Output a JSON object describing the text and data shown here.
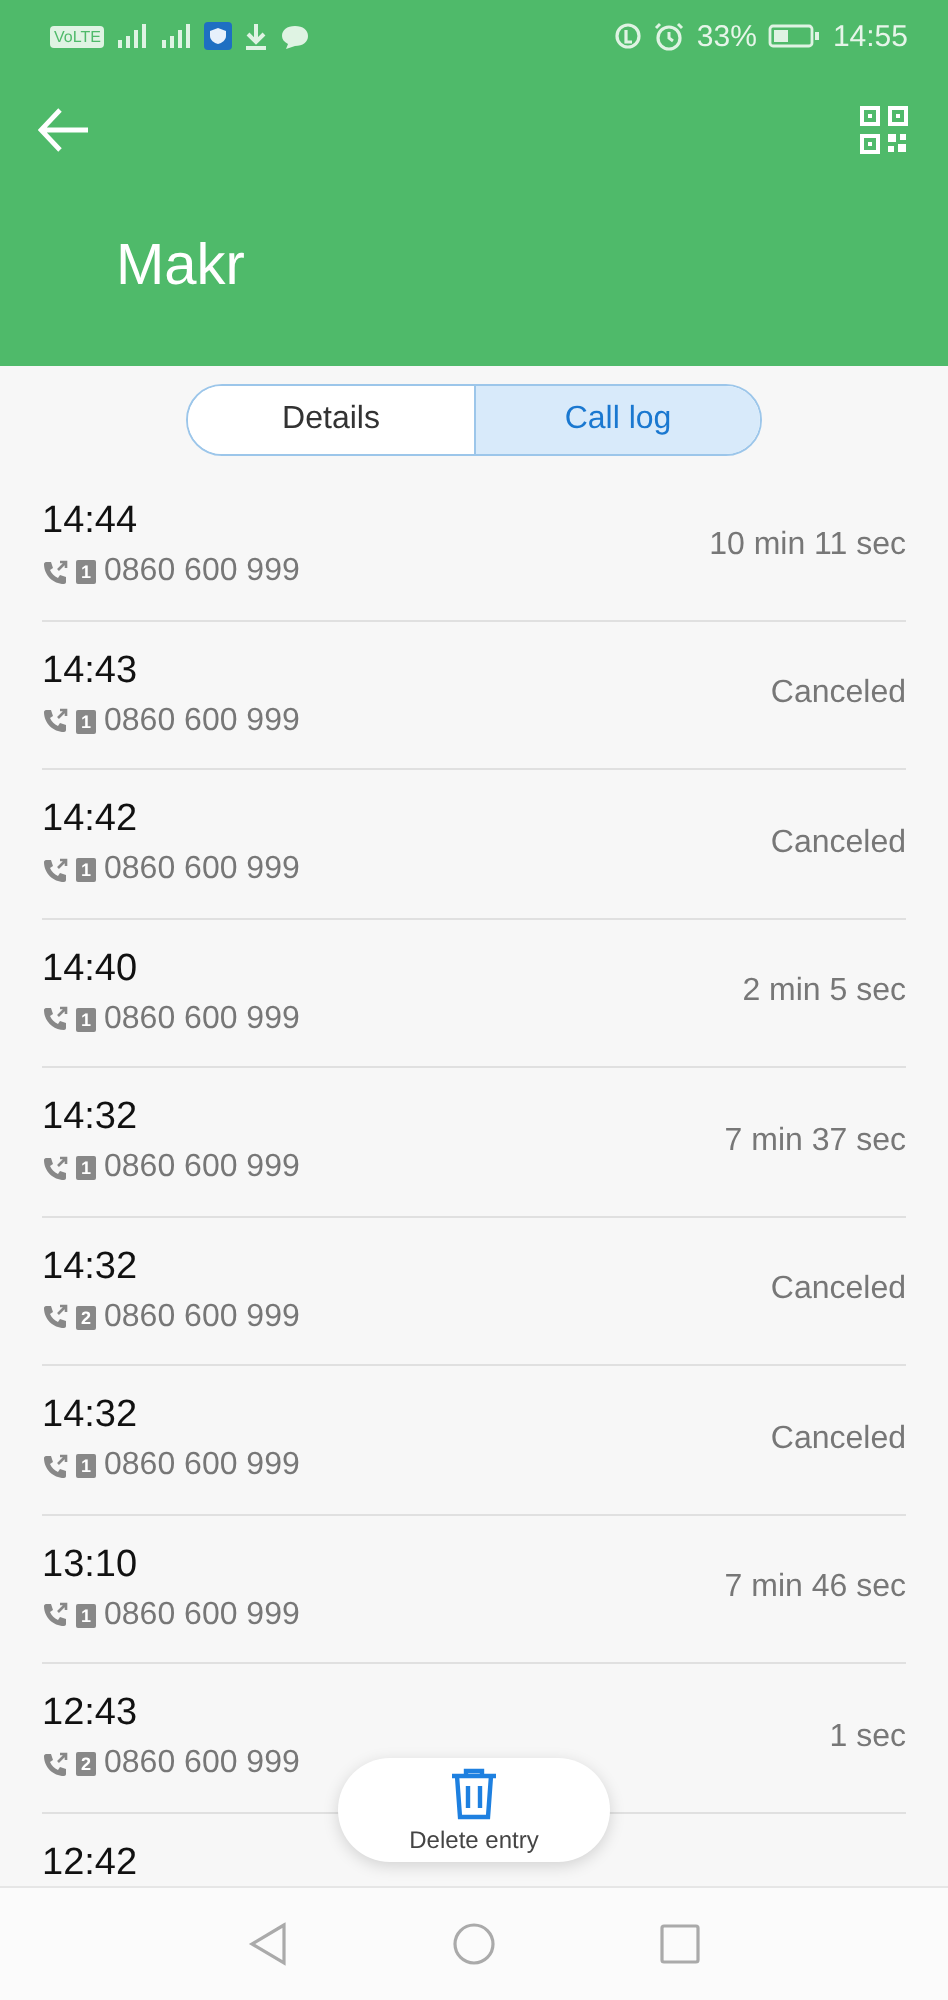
{
  "status_bar": {
    "volte": "VoLTE",
    "battery": "33%",
    "time": "14:55"
  },
  "header": {
    "title": "Makr"
  },
  "tabs": [
    {
      "label": "Details",
      "selected": false
    },
    {
      "label": "Call log",
      "selected": true
    }
  ],
  "calls": [
    {
      "time": "14:44",
      "sim": "1",
      "number": "0860 600 999",
      "result": "10 min 11 sec"
    },
    {
      "time": "14:43",
      "sim": "1",
      "number": "0860 600 999",
      "result": "Canceled"
    },
    {
      "time": "14:42",
      "sim": "1",
      "number": "0860 600 999",
      "result": "Canceled"
    },
    {
      "time": "14:40",
      "sim": "1",
      "number": "0860 600 999",
      "result": "2 min 5 sec"
    },
    {
      "time": "14:32",
      "sim": "1",
      "number": "0860 600 999",
      "result": "7 min 37 sec"
    },
    {
      "time": "14:32",
      "sim": "2",
      "number": "0860 600 999",
      "result": "Canceled"
    },
    {
      "time": "14:32",
      "sim": "1",
      "number": "0860 600 999",
      "result": "Canceled"
    },
    {
      "time": "13:10",
      "sim": "1",
      "number": "0860 600 999",
      "result": "7 min 46 sec"
    },
    {
      "time": "12:43",
      "sim": "2",
      "number": "0860 600 999",
      "result": "1 sec"
    },
    {
      "time": "12:42"
    }
  ],
  "action": {
    "label": "Delete entry"
  }
}
